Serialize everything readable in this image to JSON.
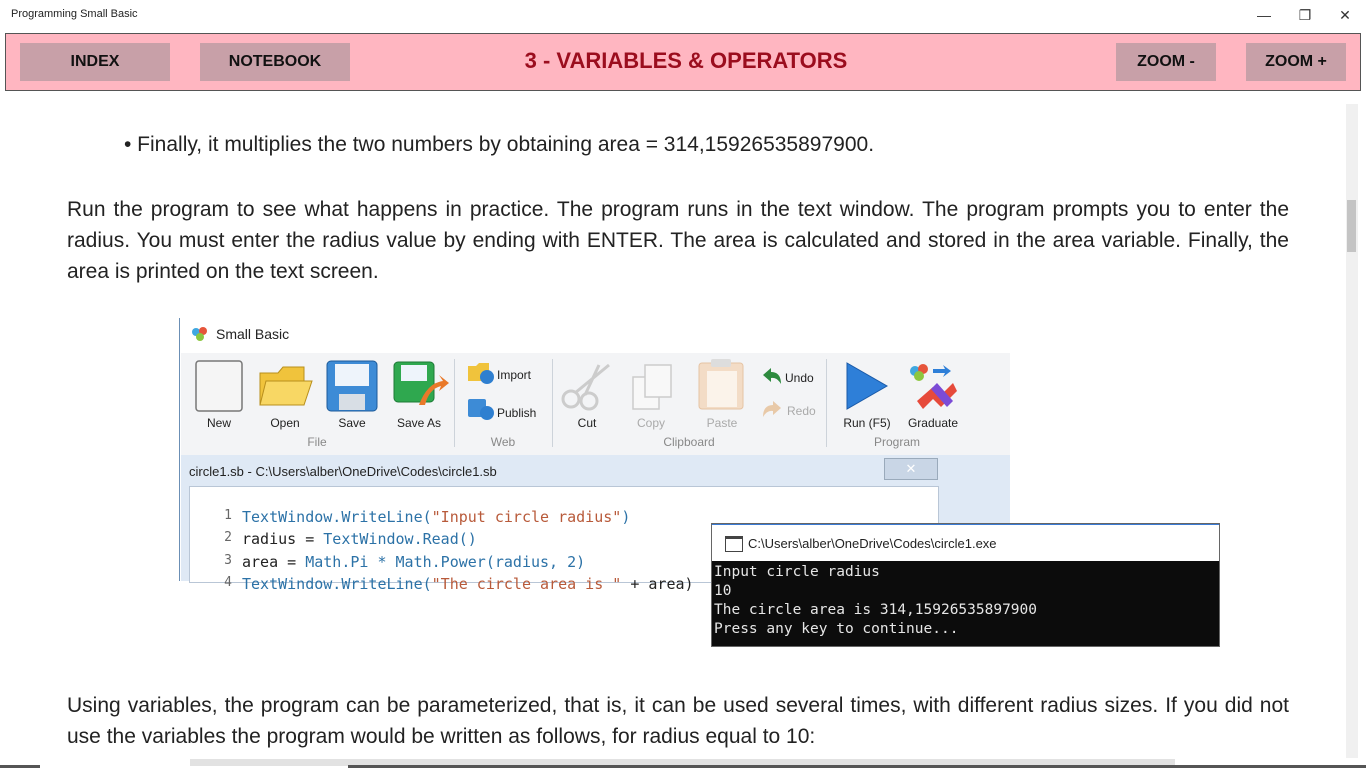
{
  "window": {
    "title": "Programming Small Basic",
    "minimize_glyph": "—",
    "restore_glyph": "❐",
    "close_glyph": "✕"
  },
  "header": {
    "index_label": "INDEX",
    "notebook_label": "NOTEBOOK",
    "title": "3 - VARIABLES & OPERATORS",
    "zoom_out_label": "ZOOM -",
    "zoom_in_label": "ZOOM +",
    "background_color": "#ffb6c1",
    "title_color": "#9b0d1e"
  },
  "content": {
    "bullet": "• Finally, it multiplies the two numbers by obtaining area = 314,15926535897900.",
    "paragraph1": " Run the program to see what happens in practice. The program runs in the text window. The program prompts you to enter the radius. You must enter the radius value by ending with ENTER. The area is calculated and stored in the area variable. Finally, the area is printed on the text screen.",
    "paragraph2": "Using variables, the program can be parameterized, that is, it can be used several times, with different radius sizes. If you did not use the variables the program would be written as follows, for radius equal to 10:"
  },
  "screenshot": {
    "app_title": "Small Basic",
    "ribbon": {
      "file": {
        "group": "File",
        "new": "New",
        "open": "Open",
        "save": "Save",
        "save_as": "Save As"
      },
      "web": {
        "group": "Web",
        "import": "Import",
        "publish": "Publish"
      },
      "clipboard": {
        "group": "Clipboard",
        "cut": "Cut",
        "copy": "Copy",
        "paste": "Paste",
        "undo": "Undo",
        "redo": "Redo"
      },
      "program": {
        "group": "Program",
        "run": "Run (F5)",
        "graduate": "Graduate"
      }
    },
    "editor": {
      "title": "circle1.sb - C:\\Users\\alber\\OneDrive\\Codes\\circle1.sb",
      "close_glyph": "✕",
      "lines": [
        {
          "num": "1",
          "a": "TextWindow.WriteLine(",
          "b": "\"Input circle radius\"",
          "c": ")"
        },
        {
          "num": "2",
          "a": "radius = ",
          "b": "TextWindow.Read()",
          "c": ""
        },
        {
          "num": "3",
          "a": "area = ",
          "b": "Math.Pi * Math.Power(radius, 2)",
          "c": ""
        },
        {
          "num": "4",
          "a": "TextWindow.WriteLine(",
          "b": "\"The circle area is \"",
          "c": " + area)"
        }
      ]
    },
    "console": {
      "title": "C:\\Users\\alber\\OneDrive\\Codes\\circle1.exe",
      "lines": [
        "Input circle radius",
        "10",
        "The circle area is 314,15926535897900",
        "Press any key to continue..."
      ]
    }
  }
}
